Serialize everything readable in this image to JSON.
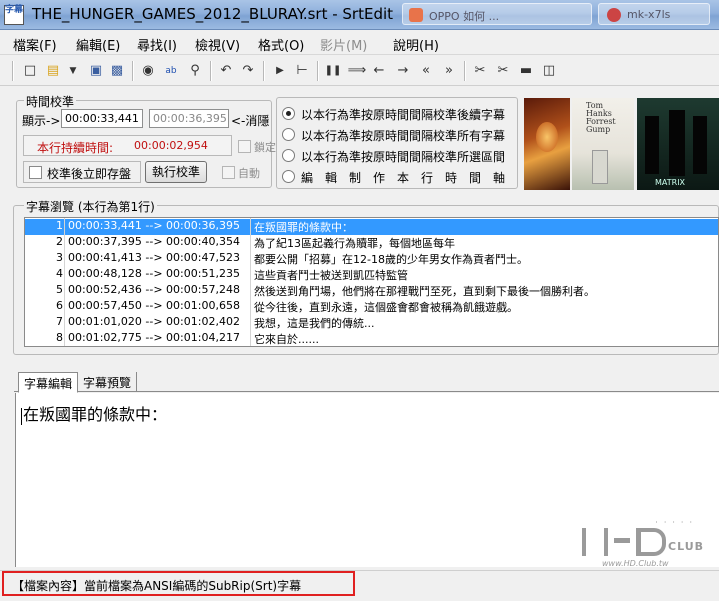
{
  "window": {
    "title": "THE_HUNGER_GAMES_2012_BLURAY.srt - SrtEdit",
    "icon_text": "字幕",
    "bg_tab_1": "OPPO 如何 ...",
    "bg_tab_2": "mk-x7ls"
  },
  "menu": {
    "items": [
      {
        "label": "檔案(F)"
      },
      {
        "label": "編輯(E)"
      },
      {
        "label": "尋找(I)"
      },
      {
        "label": "檢視(V)"
      },
      {
        "label": "格式(O)"
      },
      {
        "label": "影片(M)"
      },
      {
        "label": "說明(H)"
      }
    ]
  },
  "toolbar": {
    "icons": [
      "new-file-icon",
      "open-folder-icon",
      "save-icon",
      "save-as-icon",
      "find-icon",
      "replace-icon",
      "zoom-icon",
      "undo-icon",
      "redo-icon",
      "play-icon",
      "timeline-icon",
      "pause-icon",
      "sync-icon",
      "prev-icon",
      "next-icon",
      "rewind-icon",
      "fast-forward-icon",
      "cut-left-icon",
      "cut-right-icon",
      "film-icon",
      "export-icon"
    ]
  },
  "time_panel": {
    "title": "時間校準",
    "display_label": "顯示->",
    "start_time": "00:00:33,441",
    "end_time": "00:00:36,395",
    "hide_label": "<-消隱",
    "duration_label": "本行持續時間:",
    "duration_value": "00:00:02,954",
    "lock_label": "鎖定",
    "save_after_label": "校準後立即存盤",
    "run_button": "執行校準",
    "auto_label": "自動",
    "radio_1": "以本行為準按原時間間隔校準後續字幕",
    "radio_2": "以本行為準按原時間間隔校準所有字幕",
    "radio_3": "以本行為準按原時間間隔校準所選區間",
    "radio_4": "編　輯　制　作　本　行　時　間　軸"
  },
  "posters": {
    "forrest_title": "Tom Hanks Forrest Gump",
    "matrix_title": "MATRIX"
  },
  "subtitle_list": {
    "title": "字幕瀏覽 (本行為第1行)",
    "rows": [
      {
        "num": "1",
        "time": "00:00:33,441 --> 00:00:36,395",
        "text": "在叛國罪的條款中："
      },
      {
        "num": "2",
        "time": "00:00:37,395 --> 00:00:40,354",
        "text": "為了紀13區起義行為贖罪，每個地區每年"
      },
      {
        "num": "3",
        "time": "00:00:41,413 --> 00:00:47,523",
        "text": "都要公開「招募」在12-18歲的少年男女作為貢者鬥士。"
      },
      {
        "num": "4",
        "time": "00:00:48,128 --> 00:00:51,235",
        "text": "這些貢者鬥士被送到凱匹特監管"
      },
      {
        "num": "5",
        "time": "00:00:52,436 --> 00:00:57,248",
        "text": "然後送到角鬥場，他們將在那裡戰鬥至死，直到剩下最後一個勝利者。"
      },
      {
        "num": "6",
        "time": "00:00:57,450 --> 00:01:00,658",
        "text": "從今往後，直到永遠，這個盛會都會被稱為飢餓遊戲。"
      },
      {
        "num": "7",
        "time": "00:01:01,020 --> 00:01:02,402",
        "text": "我想，這是我們的傳統..."
      },
      {
        "num": "8",
        "time": "00:01:02,775 --> 00:01:04,217",
        "text": "它來自於......"
      }
    ]
  },
  "tabs": {
    "edit": "字幕編輯",
    "preview": "字幕預覽"
  },
  "editor": {
    "text": "在叛國罪的條款中："
  },
  "watermark": {
    "site": "www.HD.Club.tw",
    "club": "CLUB"
  },
  "status": {
    "text": "【檔案內容】當前檔案為ANSI編碼的SubRip(Srt)字幕"
  }
}
